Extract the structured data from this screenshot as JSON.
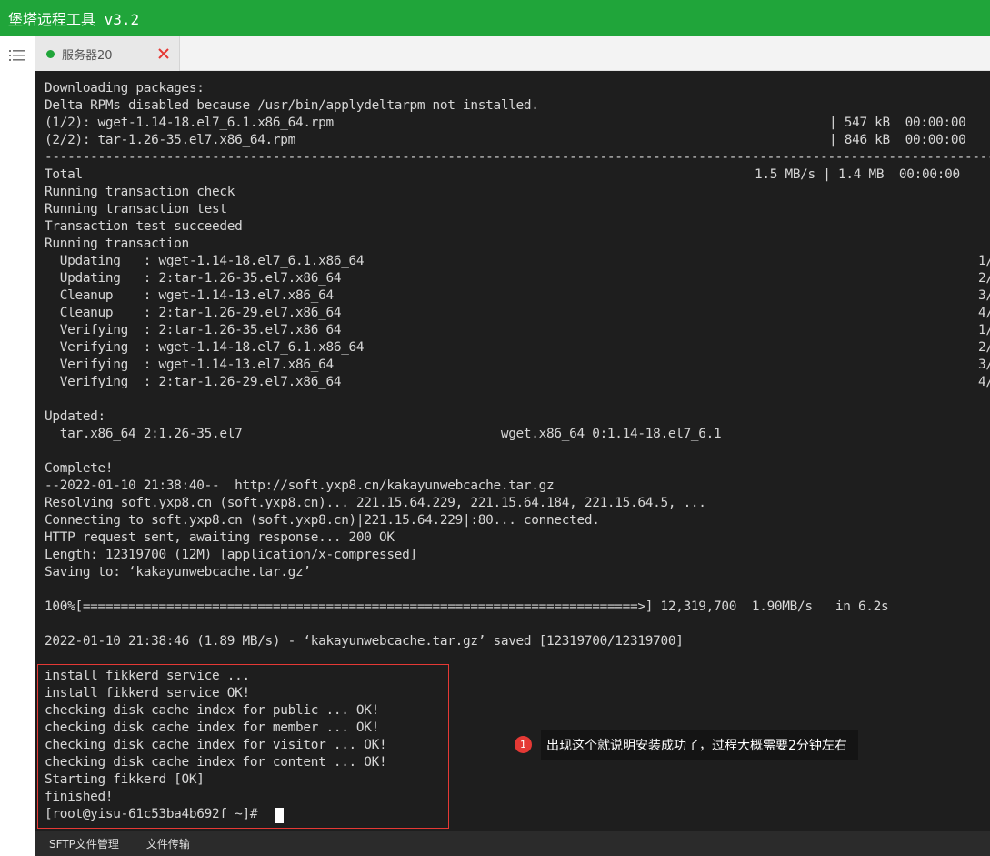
{
  "window": {
    "title": "堡塔远程工具 v3.2"
  },
  "tabs": [
    {
      "label": "服务器20",
      "status_color": "#20a53a"
    }
  ],
  "terminal": {
    "lines": [
      "Downloading packages:",
      "Delta RPMs disabled because /usr/bin/applydeltarpm not installed.",
      "(1/2): wget-1.14-18.el7_6.1.x86_64.rpm",
      "(2/2): tar-1.26-35.el7.x86_64.rpm",
      "------------------------------------------------------------------------------------------------------------------------------",
      "Total",
      "Running transaction check",
      "Running transaction test",
      "Transaction test succeeded",
      "Running transaction",
      "  Updating   : wget-1.14-18.el7_6.1.x86_64",
      "  Updating   : 2:tar-1.26-35.el7.x86_64",
      "  Cleanup    : wget-1.14-13.el7.x86_64",
      "  Cleanup    : 2:tar-1.26-29.el7.x86_64",
      "  Verifying  : 2:tar-1.26-35.el7.x86_64",
      "  Verifying  : wget-1.14-18.el7_6.1.x86_64",
      "  Verifying  : wget-1.14-13.el7.x86_64",
      "  Verifying  : 2:tar-1.26-29.el7.x86_64",
      "",
      "Updated:",
      "  tar.x86_64 2:1.26-35.el7                                  wget.x86_64 0:1.14-18.el7_6.1",
      "",
      "Complete!",
      "--2022-01-10 21:38:40--  http://soft.yxp8.cn/kakayunwebcache.tar.gz",
      "Resolving soft.yxp8.cn (soft.yxp8.cn)... 221.15.64.229, 221.15.64.184, 221.15.64.5, ...",
      "Connecting to soft.yxp8.cn (soft.yxp8.cn)|221.15.64.229|:80... connected.",
      "HTTP request sent, awaiting response... 200 OK",
      "Length: 12319700 (12M) [application/x-compressed]",
      "Saving to: ‘kakayunwebcache.tar.gz’",
      "",
      "100%[=========================================================================>] 12,319,700  1.90MB/s   in 6.2s",
      "",
      "2022-01-10 21:38:46 (1.89 MB/s) - ‘kakayunwebcache.tar.gz’ saved [12319700/12319700]",
      "",
      "install fikkerd service ...",
      "install fikkerd service OK!",
      "checking disk cache index for public ... OK!",
      "checking disk cache index for member ... OK!",
      "checking disk cache index for visitor ... OK!",
      "checking disk cache index for content ... OK!",
      "Starting fikkerd [OK]",
      "finished!",
      "[root@yisu-61c53ba4b692f ~]# "
    ],
    "right_columns": {
      "pkg1": "| 547 kB  00:00:00",
      "pkg2": "| 846 kB  00:00:00",
      "total": "1.5 MB/s | 1.4 MB  00:00:00",
      "progress": [
        "1/",
        "2/",
        "3/",
        "4/",
        "1/",
        "2/",
        "3/",
        "4/"
      ]
    }
  },
  "annotation": {
    "number": "1",
    "text": "出现这个就说明安装成功了，过程大概需要2分钟左右",
    "color": "#e53935"
  },
  "bottombar": {
    "sftp_label": "SFTP文件管理",
    "transfer_label": "文件传输"
  }
}
